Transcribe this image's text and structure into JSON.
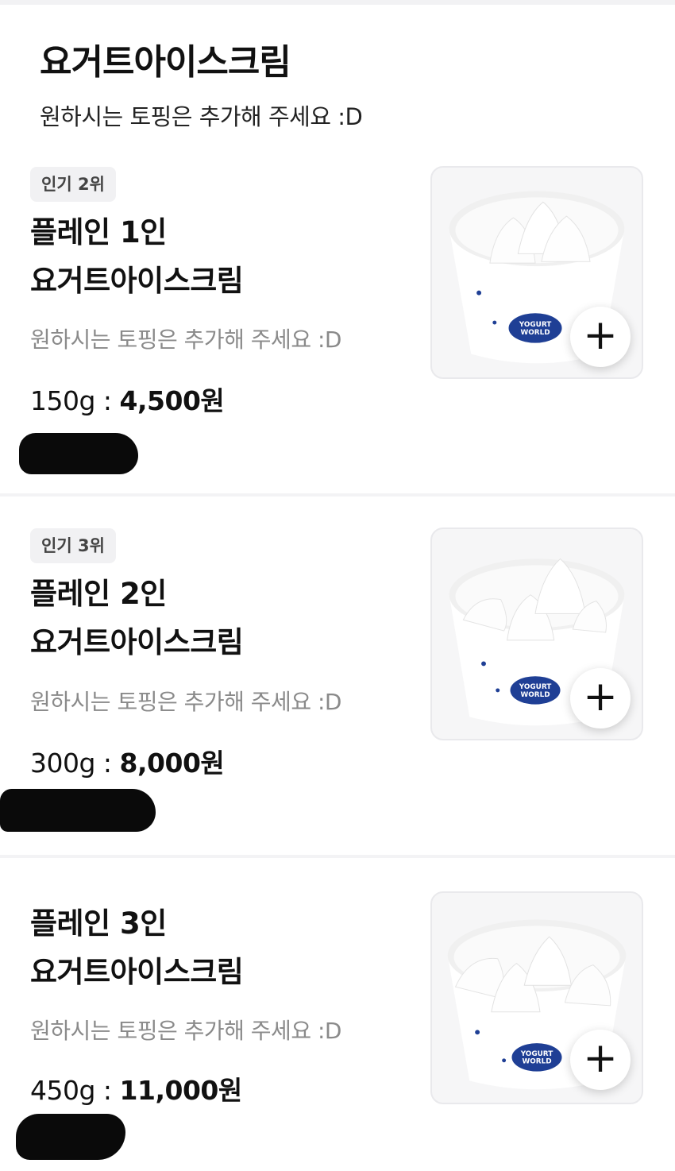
{
  "page": {
    "title": "요거트아이스크림",
    "subtitle": "원하시는 토핑은 추가해 주세요 :D"
  },
  "products": [
    {
      "badge": "인기 2위",
      "name_line1": "플레인 1인",
      "name_line2": "요거트아이스크림",
      "description": "원하시는 토핑은 추가해 주세요 :D",
      "weight": "150g",
      "separator": " : ",
      "price": "4,500원",
      "add_icon": "plus-icon",
      "cup_brand_line1": "YOGURT",
      "cup_brand_line2": "WORLD"
    },
    {
      "badge": "인기 3위",
      "name_line1": "플레인 2인",
      "name_line2": "요거트아이스크림",
      "description": "원하시는 토핑은 추가해 주세요 :D",
      "weight": "300g",
      "separator": " : ",
      "price": "8,000원",
      "add_icon": "plus-icon",
      "cup_brand_line1": "YOGURT",
      "cup_brand_line2": "WORLD"
    },
    {
      "name_line1": "플레인 3인",
      "name_line2": "요거트아이스크림",
      "description": "원하시는 토핑은 추가해 주세요 :D",
      "weight": "450g",
      "separator": " : ",
      "price": "11,000원",
      "add_icon": "plus-icon",
      "cup_brand_line1": "YOGURT",
      "cup_brand_line2": "WORLD"
    }
  ],
  "colors": {
    "cup_logo": "#1f3f95",
    "redaction": "#0a0a0a"
  }
}
